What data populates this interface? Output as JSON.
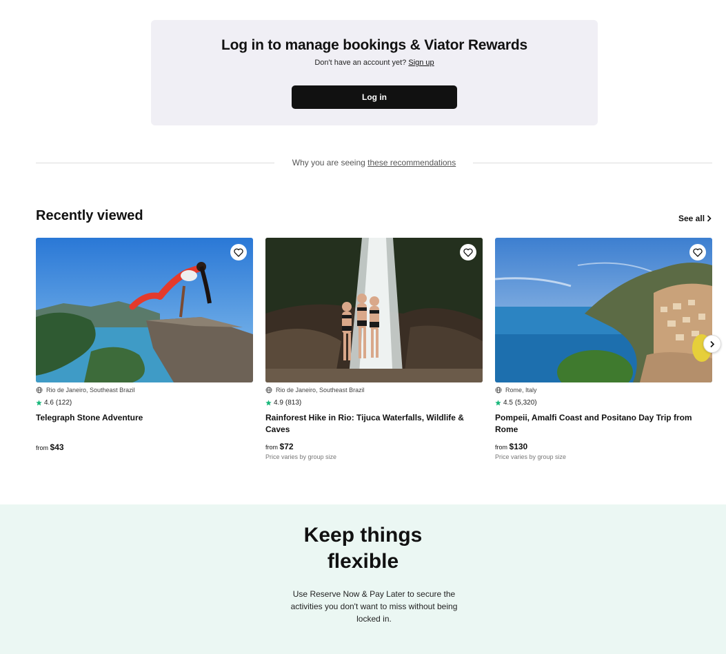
{
  "login": {
    "title": "Log in to manage bookings & Viator Rewards",
    "subtitle_prefix": "Don't have an account yet?",
    "signup_link": "Sign up",
    "button_label": "Log in"
  },
  "recommendations": {
    "prefix": "Why you are seeing",
    "link": "these recommendations"
  },
  "recently_viewed": {
    "title": "Recently viewed",
    "see_all": "See all",
    "cards": [
      {
        "location": "Rio de Janeiro, Southeast Brazil",
        "rating": "4.6",
        "reviews": "(122)",
        "title": "Telegraph Stone Adventure",
        "price_prefix": "from",
        "price": "$43",
        "price_note": ""
      },
      {
        "location": "Rio de Janeiro, Southeast Brazil",
        "rating": "4.9",
        "reviews": "(813)",
        "title": "Rainforest Hike in Rio: Tijuca Waterfalls, Wildlife & Caves",
        "price_prefix": "from",
        "price": "$72",
        "price_note": "Price varies by group size"
      },
      {
        "location": "Rome, Italy",
        "rating": "4.5",
        "reviews": "(5,320)",
        "title": "Pompeii, Amalfi Coast and Positano Day Trip from Rome",
        "price_prefix": "from",
        "price": "$130",
        "price_note": "Price varies by group size"
      }
    ]
  },
  "flexible": {
    "title_line1": "Keep things",
    "title_line2": "flexible",
    "text": "Use Reserve Now & Pay Later to secure the activities you don't want to miss without being locked in."
  },
  "colors": {
    "login_bg": "#f0eff5",
    "button_bg": "#111111",
    "star": "#1ab87c",
    "flex_bg": "#ebf7f3"
  }
}
